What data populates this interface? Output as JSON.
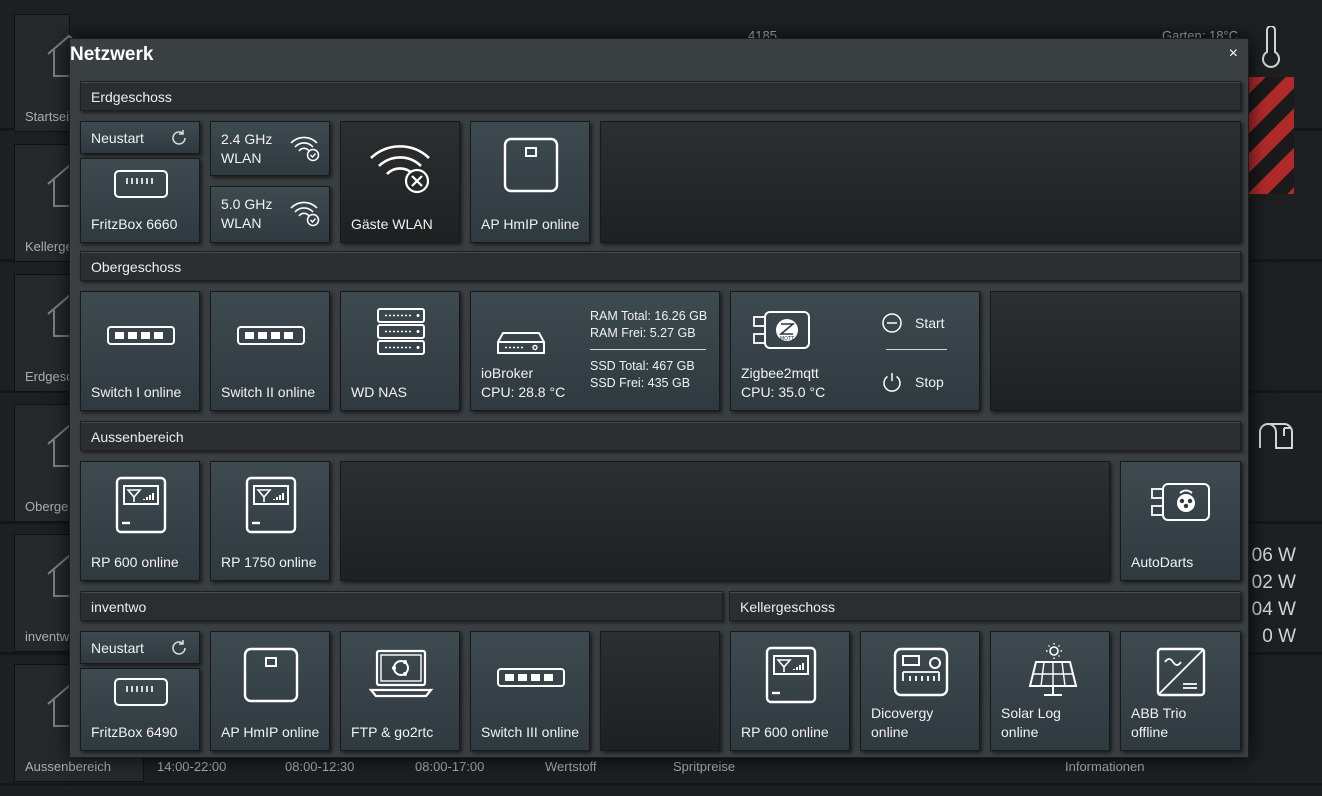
{
  "background": {
    "left_labels": [
      "Startsei",
      "Kellerge",
      "Erdgesc",
      "Oberge",
      "inventw",
      "Aussenbereich"
    ],
    "top_right_text": "Garten:  18°C",
    "top_number": "4185",
    "watts": [
      "06 W",
      "02 W",
      "04 W",
      "0 W"
    ],
    "bottom_labels": [
      "14:00-22:00",
      "08:00-12:30",
      "08:00-17:00",
      "Wertstoff",
      "Spritpreise",
      "Informationen"
    ]
  },
  "dialog": {
    "title": "Netzwerk",
    "close": "×"
  },
  "sections": {
    "erdgeschoss": "Erdgeschoss",
    "obergeschoss": "Obergeschoss",
    "aussenbereich": "Aussenbereich",
    "inventwo": "inventwo",
    "kellergeschoss": "Kellergeschoss"
  },
  "erdgeschoss": {
    "restart": "Neustart",
    "fritzbox": "FritzBox 6660",
    "wlan24": "2.4 GHz\nWLAN",
    "wlan24_a": "2.4 GHz",
    "wlan24_b": "WLAN",
    "wlan50_a": "5.0 GHz",
    "wlan50_b": "WLAN",
    "guest": "Gäste WLAN",
    "ap": "AP HmIP online"
  },
  "obergeschoss": {
    "switch1": "Switch I online",
    "switch2": "Switch II online",
    "nas": "WD NAS",
    "iobroker_a": "ioBroker",
    "iobroker_b": "CPU: 28.8 °C",
    "ram_total": "RAM Total: 16.26 GB",
    "ram_free": "RAM Frei: 5.27 GB",
    "ssd_total": "SSD Total: 467 GB",
    "ssd_free": "SSD Frei: 435 GB",
    "zigbee_a": "Zigbee2mqtt",
    "zigbee_b": "CPU: 35.0 °C",
    "start": "Start",
    "stop": "Stop"
  },
  "aussenbereich": {
    "rp600": "RP 600 online",
    "rp1750": "RP 1750 online",
    "autodarts": "AutoDarts"
  },
  "inventwo": {
    "restart": "Neustart",
    "fritzbox": "FritzBox 6490",
    "ap": "AP HmIP online",
    "ftp": "FTP & go2rtc",
    "switch3": "Switch III online"
  },
  "kellergeschoss": {
    "rp600": "RP 600 online",
    "discovergy_a": "Dicovergy",
    "discovergy_b": "online",
    "solar_a": "Solar Log",
    "solar_b": "online",
    "abb_a": "ABB Trio",
    "abb_b": "offline"
  }
}
